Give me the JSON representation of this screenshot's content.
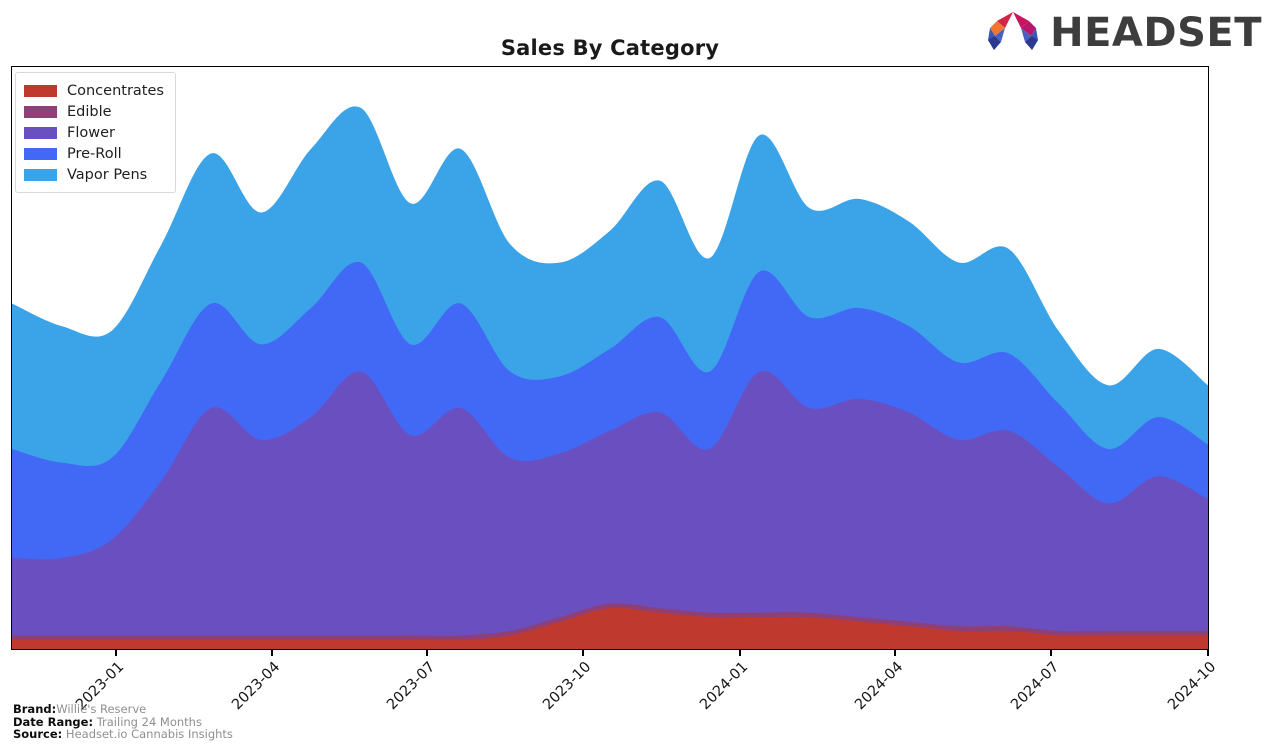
{
  "header": {
    "title": "Sales By Category",
    "logo_text": "HEADSET",
    "logo_colors": {
      "orange": "#f2762e",
      "red": "#d62246",
      "crimson": "#c7155e",
      "magenta": "#b8176b",
      "navy": "#2b3a8f",
      "blue": "#3d55b5",
      "word": "#3d3d3d"
    }
  },
  "legend": {
    "items": [
      {
        "label": "Concentrates",
        "color": "#c0392f"
      },
      {
        "label": "Edible",
        "color": "#8e4076"
      },
      {
        "label": "Flower",
        "color": "#6a4fc0"
      },
      {
        "label": "Pre-Roll",
        "color": "#4169f5"
      },
      {
        "label": "Vapor Pens",
        "color": "#3ba3e8"
      }
    ]
  },
  "xaxis": {
    "ticks": [
      {
        "label": "2023-01",
        "pos": 0.0877
      },
      {
        "label": "2023-04",
        "pos": 0.2178
      },
      {
        "label": "2023-07",
        "pos": 0.3472
      },
      {
        "label": "2023-10",
        "pos": 0.4774
      },
      {
        "label": "2024-01",
        "pos": 0.6085
      },
      {
        "label": "2024-04",
        "pos": 0.7379
      },
      {
        "label": "2024-07",
        "pos": 0.8681
      },
      {
        "label": "2024-10",
        "pos": 0.9991
      }
    ]
  },
  "footer": {
    "rows": [
      {
        "key": "Brand:",
        "value": "Willie's Reserve"
      },
      {
        "key": "Date Range:",
        "value": " Trailing 24 Months"
      },
      {
        "key": "Source:",
        "value": " Headset.io Cannabis Insights"
      }
    ]
  },
  "chart_data": {
    "type": "area",
    "stacked": true,
    "title": "Sales By Category",
    "xlabel": "",
    "ylabel": "",
    "grid": false,
    "legend_position": "upper-left",
    "x": [
      "2022-10",
      "2022-11",
      "2022-12",
      "2023-01",
      "2023-02",
      "2023-03",
      "2023-04",
      "2023-05",
      "2023-06",
      "2023-07",
      "2023-08",
      "2023-09",
      "2023-10",
      "2023-11",
      "2023-12",
      "2024-01",
      "2024-02",
      "2024-03",
      "2024-04",
      "2024-05",
      "2024-06",
      "2024-07",
      "2024-08",
      "2024-09",
      "2024-10"
    ],
    "series": [
      {
        "name": "Concentrates",
        "color": "#c0392f",
        "values": [
          2,
          2,
          2,
          2,
          2,
          2,
          2,
          2,
          2,
          2,
          3,
          6,
          9,
          8,
          7,
          7,
          7,
          6,
          5,
          4,
          4,
          3,
          3,
          3,
          3
        ]
      },
      {
        "name": "Edible",
        "color": "#8e4076",
        "values": [
          1,
          1,
          1,
          1,
          1,
          1,
          1,
          1,
          1,
          1,
          1,
          1,
          1,
          1,
          1,
          1,
          1,
          1,
          1,
          1,
          1,
          1,
          1,
          1,
          1
        ]
      },
      {
        "name": "Flower",
        "color": "#6a4fc0",
        "values": [
          17,
          17,
          21,
          34,
          50,
          43,
          48,
          58,
          44,
          50,
          38,
          36,
          38,
          43,
          36,
          53,
          45,
          48,
          46,
          41,
          43,
          36,
          28,
          34,
          29
        ]
      },
      {
        "name": "Pre-Roll",
        "color": "#4169f5",
        "values": [
          24,
          21,
          18,
          22,
          23,
          21,
          24,
          24,
          20,
          23,
          19,
          17,
          18,
          21,
          17,
          22,
          20,
          20,
          19,
          17,
          17,
          14,
          12,
          13,
          12
        ]
      },
      {
        "name": "Vapor Pens",
        "color": "#3ba3e8",
        "values": [
          32,
          30,
          28,
          30,
          33,
          29,
          35,
          34,
          31,
          34,
          28,
          25,
          26,
          30,
          25,
          30,
          24,
          24,
          23,
          22,
          23,
          16,
          14,
          15,
          13
        ]
      }
    ],
    "ylim": [
      0,
      128
    ],
    "note": "Y axis has no tick labels; values are relative sales magnitude read from stacked band thicknesses."
  }
}
